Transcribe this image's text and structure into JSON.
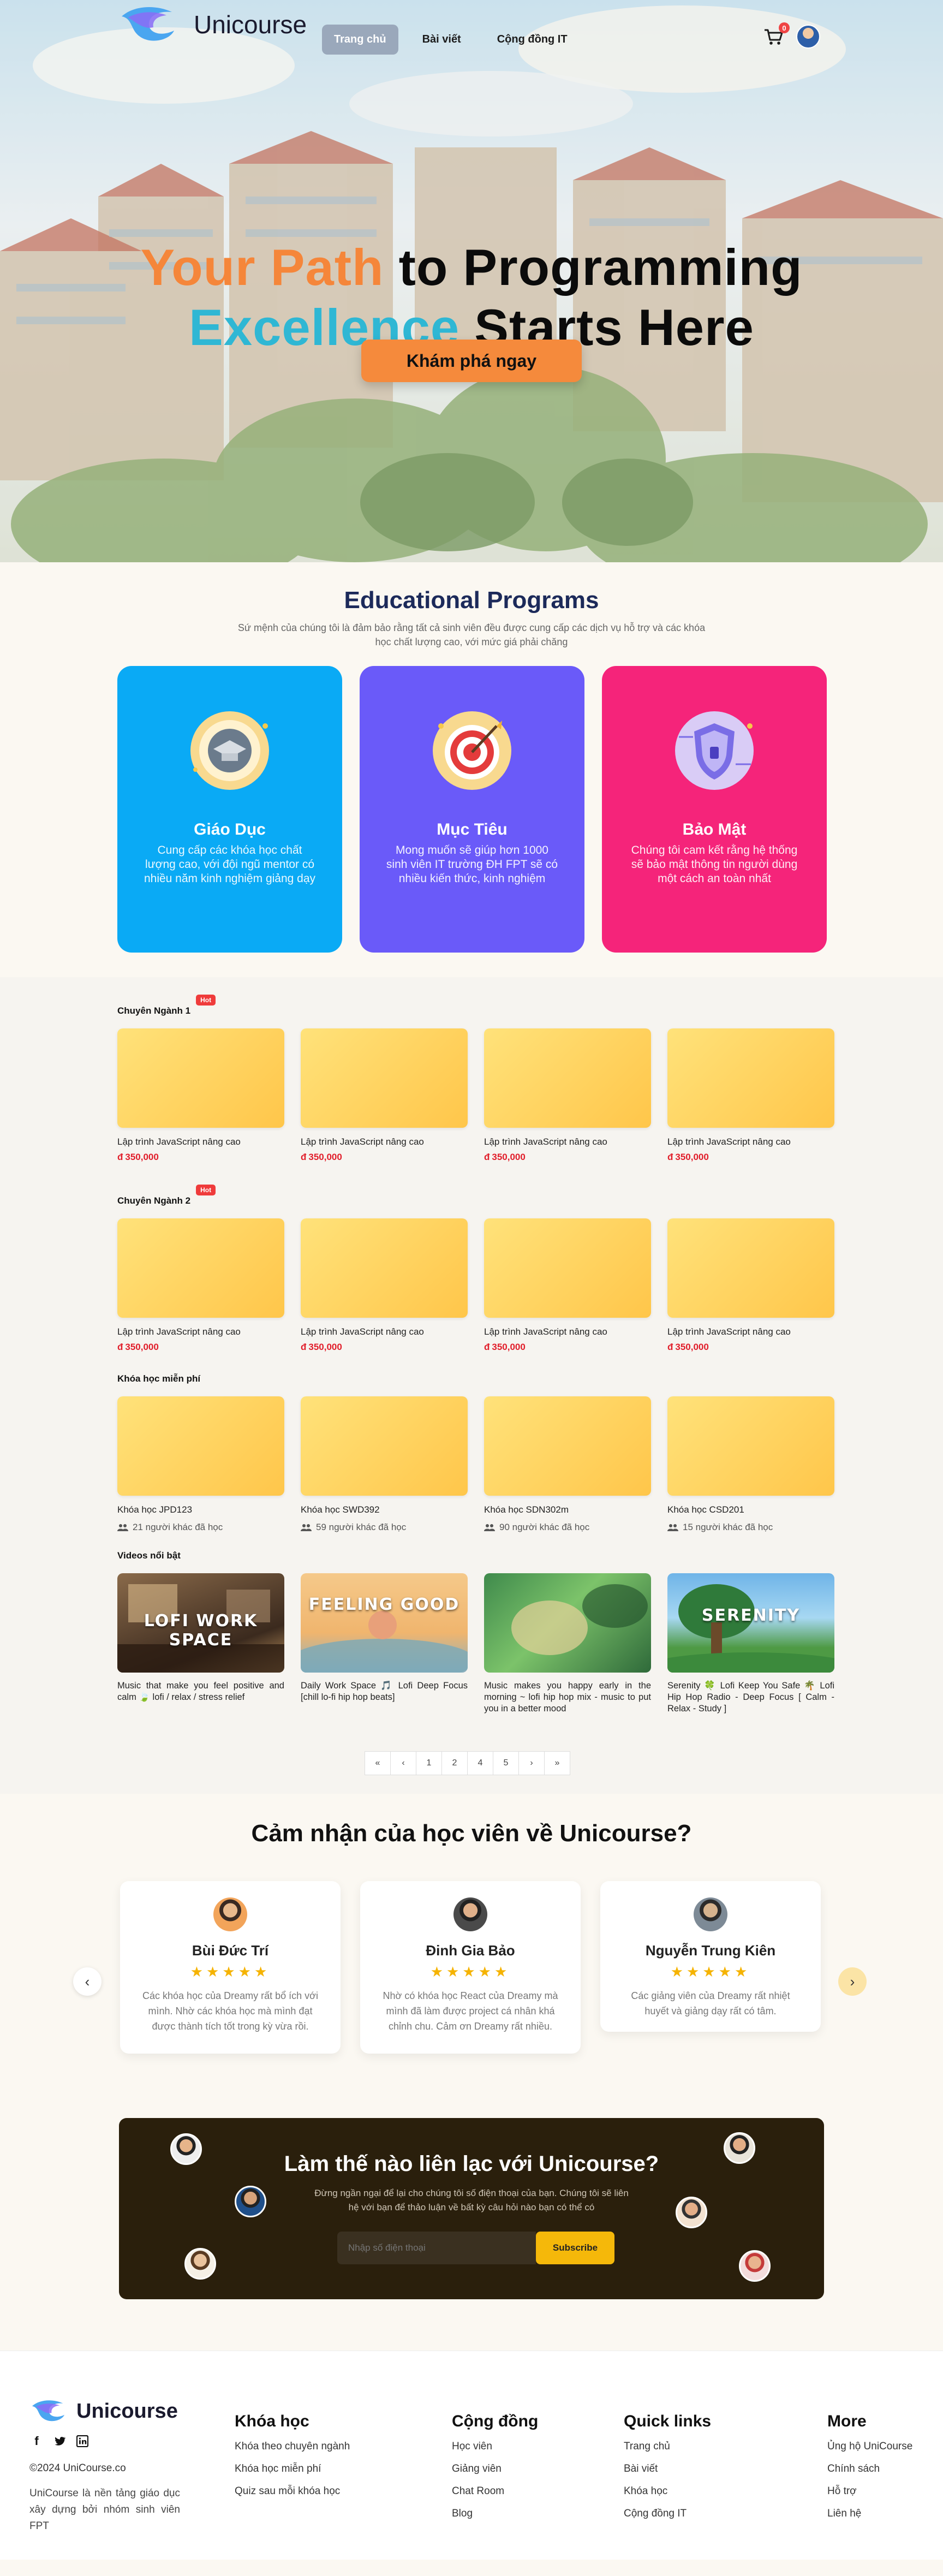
{
  "brand": {
    "name": "Unicourse"
  },
  "nav": {
    "items": [
      {
        "label": "Trang chủ",
        "active": true
      },
      {
        "label": "Bài viết",
        "active": false
      },
      {
        "label": "Cộng đồng IT",
        "active": false
      }
    ],
    "cart_count": "0"
  },
  "hero": {
    "line1_a": "Your Path",
    "line1_b": " to Programming",
    "line2_a": "Excellence",
    "line2_b": " Starts Here",
    "cta": "Khám phá ngay"
  },
  "programs": {
    "title": "Educational Programs",
    "subtitle": "Sứ mệnh của chúng tôi là đảm bảo rằng tất cả sinh viên đều được cung cấp các dịch vụ hỗ trợ và các khóa học chất lượng cao, với mức giá phải chăng",
    "cards": [
      {
        "name": "Giáo Dục",
        "desc": "Cung cấp các khóa học chất lượng cao, với đội ngũ mentor có nhiều năm kinh nghiệm giảng dạy",
        "color": "#0aaaf5"
      },
      {
        "name": "Mục Tiêu",
        "desc": "Mong muốn sẽ giúp hơn 1000 sinh viên IT trường ĐH FPT sẽ có nhiều kiến thức, kinh nghiệm",
        "color": "#6a5af9"
      },
      {
        "name": "Bảo Mật",
        "desc": "Chúng tôi cam kết rằng hệ thống sẽ bảo mật thông tin người dùng một cách an toàn nhất",
        "color": "#f5247a"
      }
    ]
  },
  "courses": {
    "hot_label": "Hot",
    "currency": "đ",
    "major1": {
      "title": "Chuyên Ngành 1",
      "items": [
        {
          "name": "Lập trình JavaScript nâng cao",
          "price": "350,000"
        },
        {
          "name": "Lập trình JavaScript nâng cao",
          "price": "350,000"
        },
        {
          "name": "Lập trình JavaScript nâng cao",
          "price": "350,000"
        },
        {
          "name": "Lập trình JavaScript nâng cao",
          "price": "350,000"
        }
      ]
    },
    "major2": {
      "title": "Chuyên Ngành 2",
      "items": [
        {
          "name": "Lập trình JavaScript nâng cao",
          "price": "350,000"
        },
        {
          "name": "Lập trình JavaScript nâng cao",
          "price": "350,000"
        },
        {
          "name": "Lập trình JavaScript nâng cao",
          "price": "350,000"
        },
        {
          "name": "Lập trình JavaScript nâng cao",
          "price": "350,000"
        }
      ]
    },
    "free": {
      "title": "Khóa học miễn phí",
      "items": [
        {
          "name": "Khóa học JPD123",
          "learners": "21 người khác đã học"
        },
        {
          "name": "Khóa học SWD392",
          "learners": "59 người khác đã học"
        },
        {
          "name": "Khóa học SDN302m",
          "learners": "90 người khác đã học"
        },
        {
          "name": "Khóa học CSD201",
          "learners": "15 người khác đã học"
        }
      ]
    },
    "videos": {
      "title": "Videos nổi bật",
      "items": [
        {
          "title": "Music that make you feel positive and calm 🍃 lofi / relax / stress relief",
          "caption": "LOFI WORK SPACE"
        },
        {
          "title": "Daily Work Space 🎵 Lofi Deep Focus [chill lo-fi hip hop beats]",
          "caption": "FEELING GOOD"
        },
        {
          "title": "Music makes you happy early in the morning ~ lofi hip hop mix - music to put you in a better mood",
          "caption": ""
        },
        {
          "title": "Serenity 🍀 Lofi Keep You Safe 🌴 Lofi Hip Hop Radio - Deep Focus [ Calm - Relax - Study ]",
          "caption": "SERENITY"
        }
      ]
    },
    "pager": [
      "«",
      "‹",
      "1",
      "2",
      "4",
      "5",
      "›",
      "»"
    ]
  },
  "testimonials": {
    "title": "Cảm nhận của học viên về Unicourse?",
    "stars": "★★★★★",
    "items": [
      {
        "name": "Bùi Đức Trí",
        "quote": "Các khóa học của Dreamy rất bổ ích với mình. Nhờ các khóa học mà mình đạt được thành tích tốt trong kỳ vừa rồi."
      },
      {
        "name": "Đinh Gia Bảo",
        "quote": "Nhờ có khóa học React của Dreamy mà mình đã làm được project cá nhân khá chỉnh chu. Cảm ơn Dreamy rất nhiều."
      },
      {
        "name": "Nguyễn Trung Kiên",
        "quote": "Các giảng viên của Dreamy rất nhiệt huyết và giảng dạy rất có tâm."
      }
    ]
  },
  "contact": {
    "title": "Làm thế nào liên lạc với Unicourse?",
    "desc": "Đừng ngần ngại để lại cho chúng tôi số điện thoại của bạn. Chúng tôi sẽ liên hệ với bạn để thảo luận về bất kỳ câu hỏi nào bạn có thể có",
    "placeholder": "Nhập số điện thoại",
    "button": "Subscribe"
  },
  "footer": {
    "copyright": "©2024 UniCourse.co",
    "desc": "UniCourse là nền tảng giáo dục xây dựng bởi nhóm sinh viên FPT",
    "columns": [
      {
        "title": "Khóa học",
        "links": [
          "Khóa theo chuyên ngành",
          "Khóa học miễn phí",
          "Quiz sau mỗi khóa học"
        ]
      },
      {
        "title": "Cộng đồng",
        "links": [
          "Học viên",
          "Giảng viên",
          "Chat Room",
          "Blog"
        ]
      },
      {
        "title": "Quick links",
        "links": [
          "Trang chủ",
          "Bài viết",
          "Khóa học",
          "Cộng đồng IT"
        ]
      },
      {
        "title": "More",
        "links": [
          "Ủng hộ UniCourse",
          "Chính sách",
          "Hỗ trợ",
          "Liên hệ"
        ]
      }
    ]
  }
}
